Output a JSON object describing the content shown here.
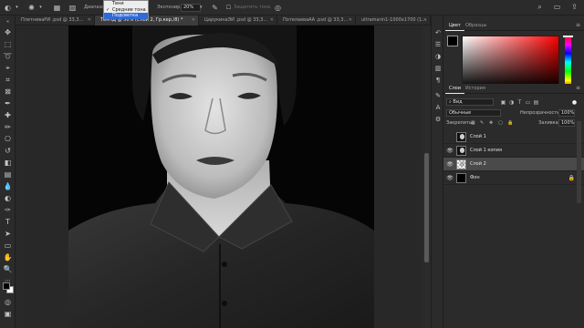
{
  "options_bar": {
    "range_label": "Диапазон:",
    "exposure_label": "Экспонир.:",
    "exposure_value": "20%",
    "protect_tones_label": "Защитить тона"
  },
  "range_dropdown": {
    "options": [
      {
        "label": "Тени",
        "checked": false,
        "highlighted": false
      },
      {
        "label": "Средние тона",
        "checked": true,
        "highlighted": false
      },
      {
        "label": "Подсветка",
        "checked": false,
        "highlighted": true
      }
    ]
  },
  "doc_tabs": [
    {
      "label": "ПлетневаРИ .psd @ 33,3...",
      "active": false
    },
    {
      "label": "ТенНД @ 50% (Слой 2, Гр.кер./8) *",
      "active": true
    },
    {
      "label": "ЦарукинаЭИ .psd @ 33,3...",
      "active": false
    },
    {
      "label": "ПотелаеваАА .psd @ 33,3...",
      "active": false
    },
    {
      "label": "ultramarin1-1000x1700 (1...",
      "active": false
    }
  ],
  "color_panel": {
    "tabs": [
      "Цвет",
      "Образцы"
    ],
    "foreground": "#000000",
    "background": "#ffffff",
    "hue": "#ff0000"
  },
  "layers_panel": {
    "tabs": [
      "Слои",
      "История"
    ],
    "kind_filter": "Вид",
    "blend_mode": "Обычные",
    "opacity_label": "Непрозрачность:",
    "opacity_value": "100%",
    "lock_label": "Закрепить:",
    "fill_label": "Заливка:",
    "fill_value": "100%",
    "layers": [
      {
        "name": "Слой 1",
        "visible": false,
        "selected": false,
        "locked": false,
        "thumb": "portrait"
      },
      {
        "name": "Слой 1 копия",
        "visible": true,
        "selected": false,
        "locked": false,
        "thumb": "portrait"
      },
      {
        "name": "Слой 2",
        "visible": true,
        "selected": true,
        "locked": false,
        "thumb": "transparent"
      },
      {
        "name": "Фон",
        "visible": true,
        "selected": false,
        "locked": true,
        "thumb": "black"
      }
    ]
  },
  "accent_color": "#2f6ad6"
}
